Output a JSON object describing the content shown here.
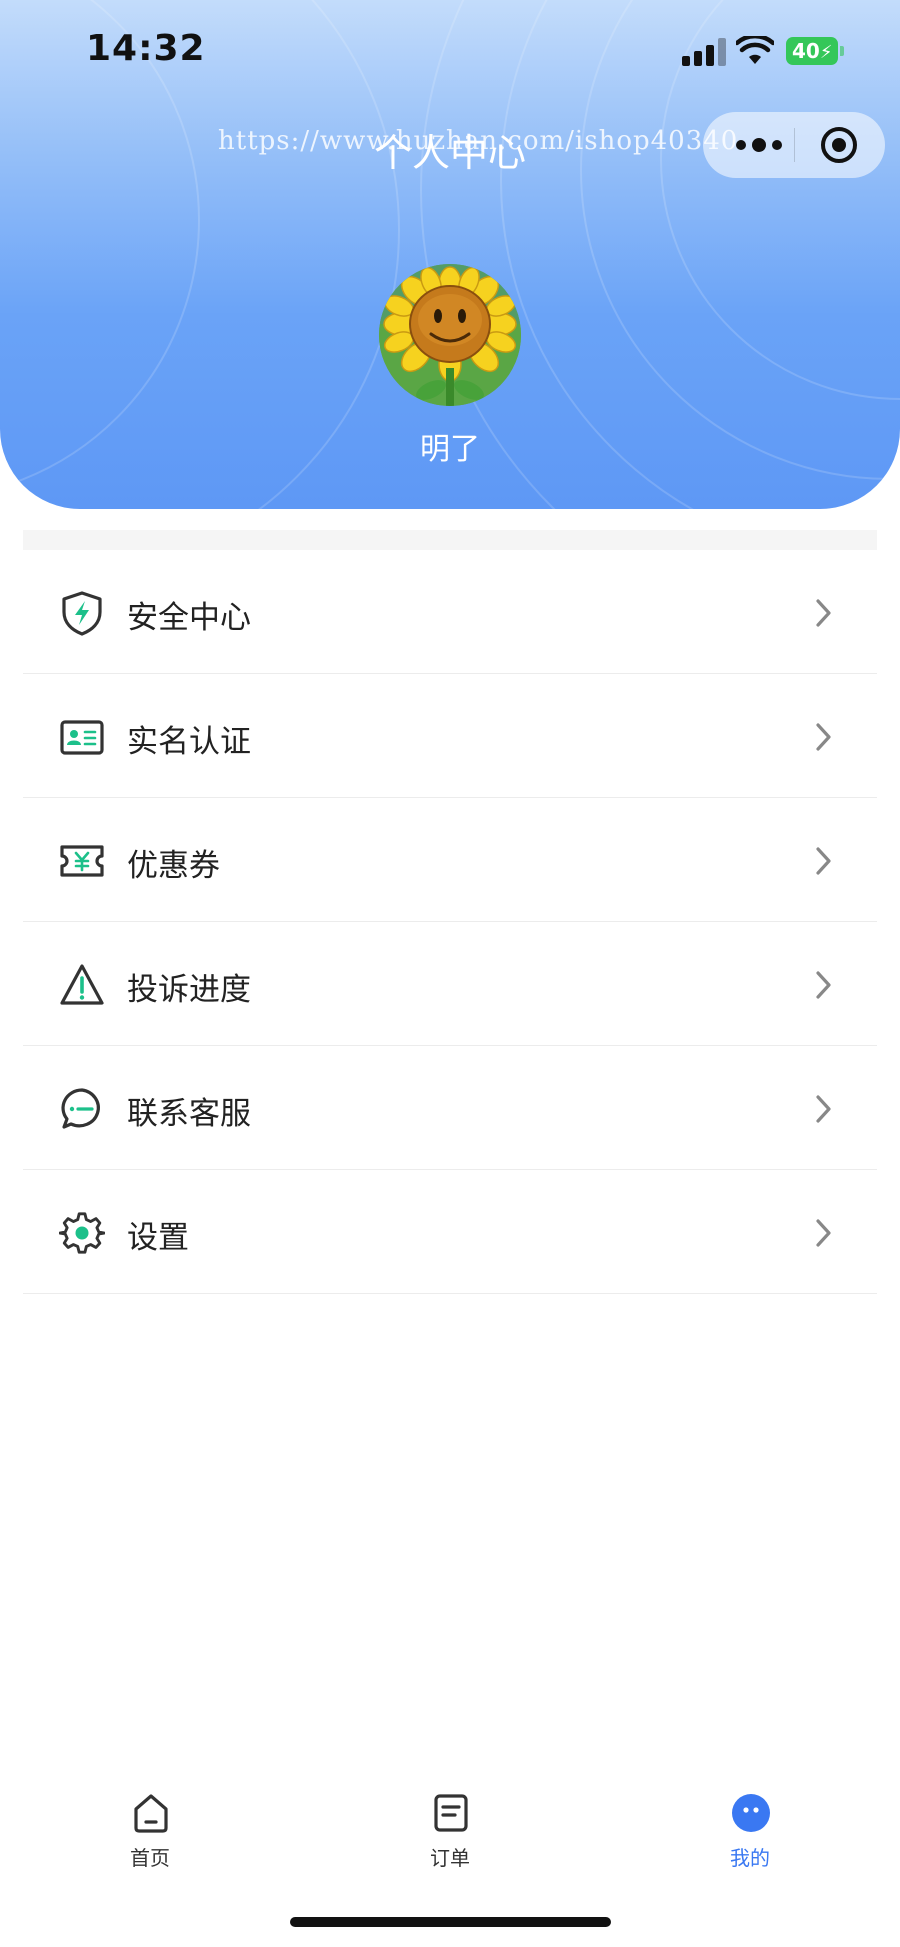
{
  "status_bar": {
    "time": "14:32",
    "battery": "40"
  },
  "header": {
    "title": "个人中心",
    "watermark": "https://www.huzhan.com/ishop40340",
    "username": "明了"
  },
  "menu": {
    "items": [
      {
        "label": "安全中心",
        "icon": "shield-lightning-icon"
      },
      {
        "label": "实名认证",
        "icon": "id-card-icon"
      },
      {
        "label": "优惠券",
        "icon": "coupon-icon"
      },
      {
        "label": "投诉进度",
        "icon": "warning-triangle-icon"
      },
      {
        "label": "联系客服",
        "icon": "chat-bubble-icon"
      },
      {
        "label": "设置",
        "icon": "gear-icon"
      }
    ]
  },
  "tabbar": {
    "items": [
      {
        "label": "首页",
        "icon": "home-icon",
        "active": false
      },
      {
        "label": "订单",
        "icon": "order-icon",
        "active": false
      },
      {
        "label": "我的",
        "icon": "profile-icon",
        "active": true
      }
    ]
  },
  "colors": {
    "accent_green": "#1cc08a",
    "tab_active": "#3a78f2",
    "icon_stroke": "#333333",
    "header_top": "#c3dcfb",
    "header_bottom": "#5e98f5"
  }
}
